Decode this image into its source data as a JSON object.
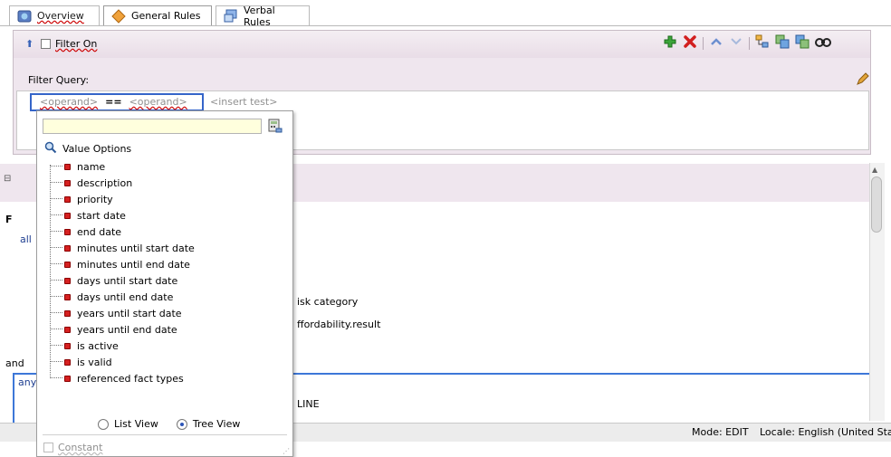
{
  "tabs": [
    {
      "label": "Overview",
      "icon": "overview-globe-icon"
    },
    {
      "label": "General Rules",
      "icon": "diamond-icon"
    },
    {
      "label": "Verbal Rules",
      "icon": "verbal-rules-icon"
    }
  ],
  "filter": {
    "toggle_label": "Filter On",
    "query_label": "Filter Query:",
    "operand_left": "<operand>",
    "operator": "==",
    "operand_right": "<operand>",
    "insert_test": "<insert test>"
  },
  "toolbar": {
    "icons": [
      "add-icon",
      "delete-icon",
      "move-up-icon",
      "move-down-icon",
      "tree-icon",
      "expand-icon",
      "collapse-icon",
      "find-icon"
    ]
  },
  "background": {
    "f_label": "F",
    "all_label": "all",
    "and_label": "and",
    "any_label": "any",
    "risk_category": "isk category",
    "affordability": "ffordability.result",
    "decline": "LINE"
  },
  "popup": {
    "search_value": "",
    "header": "Value Options",
    "items": [
      "name",
      "description",
      "priority",
      "start date",
      "end date",
      "minutes until start date",
      "minutes until end date",
      "days until start date",
      "days until end date",
      "years until start date",
      "years until end date",
      "is active",
      "is valid",
      "referenced fact types"
    ],
    "list_view": "List View",
    "tree_view": "Tree View",
    "constant": "Constant"
  },
  "status": {
    "mode": "Mode: EDIT",
    "locale": "Locale: English (United Sta"
  },
  "colors": {
    "accent_blue": "#3565c9",
    "panel_pink": "#efe6ee",
    "input_yellow": "#ffffdd"
  }
}
